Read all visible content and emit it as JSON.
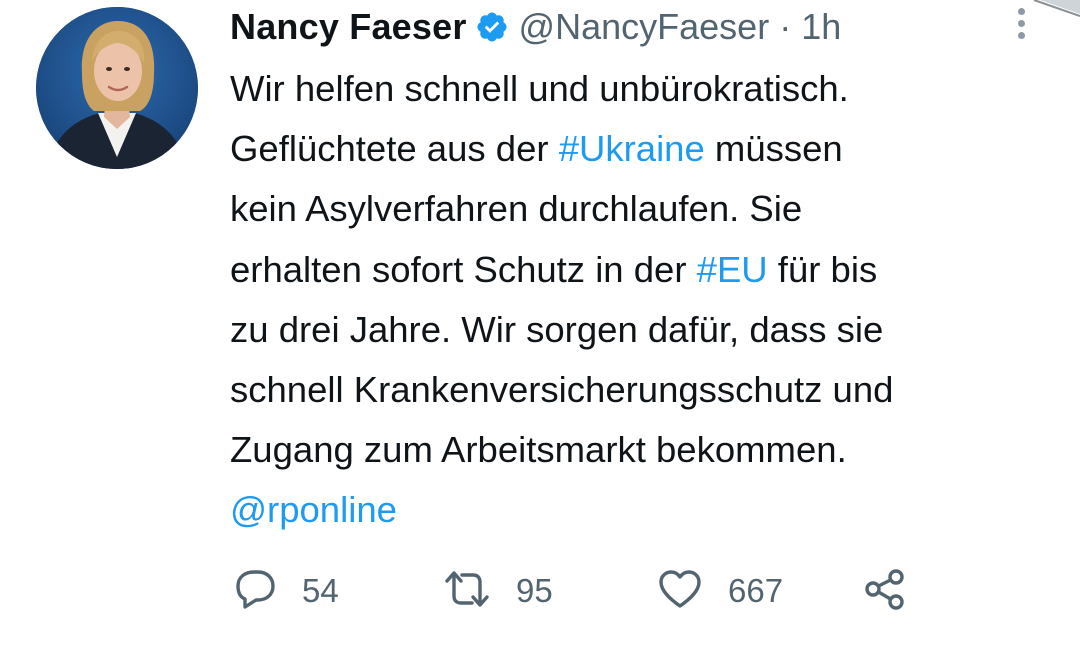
{
  "tweet": {
    "author_name": "Nancy Faeser",
    "handle": "@NancyFaeser",
    "separator": "·",
    "time": "1h",
    "lines": [
      [
        {
          "t": "Wir helfen schnell und unbürokratisch."
        }
      ],
      [
        {
          "t": "Geflüchtete aus der "
        },
        {
          "t": "#Ukraine",
          "link": true
        },
        {
          "t": " müssen"
        }
      ],
      [
        {
          "t": "kein Asylverfahren durchlaufen. Sie"
        }
      ],
      [
        {
          "t": "erhalten sofort Schutz in der "
        },
        {
          "t": "#EU",
          "link": true
        },
        {
          "t": " für bis"
        }
      ],
      [
        {
          "t": "zu drei Jahre. Wir sorgen dafür, dass sie"
        }
      ],
      [
        {
          "t": "schnell Krankenversicherungsschutz und"
        }
      ],
      [
        {
          "t": "Zugang zum Arbeitsmarkt bekommen."
        }
      ],
      [
        {
          "t": "@rponline",
          "link": true
        }
      ]
    ],
    "actions": {
      "replies": "54",
      "retweets": "95",
      "likes": "667"
    }
  },
  "colors": {
    "link": "#1d9bf0",
    "verified": "#1d9bf0",
    "muted": "#536471",
    "text": "#0f1419"
  },
  "icons": [
    "verified-badge-icon",
    "more-options-icon",
    "reply-icon",
    "retweet-icon",
    "like-icon",
    "share-icon"
  ]
}
